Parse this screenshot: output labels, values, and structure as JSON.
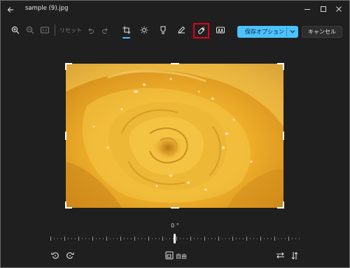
{
  "window": {
    "title": "sample (9).jpg"
  },
  "toolbar": {
    "reset_label": "リセット",
    "save_label": "保存オプション",
    "cancel_label": "キャンセル"
  },
  "crop": {
    "angle_label": "0 °",
    "aspect_label": "自由"
  },
  "colors": {
    "accent": "#4cc2ff",
    "highlight": "#e3001b",
    "background": "#202020"
  }
}
